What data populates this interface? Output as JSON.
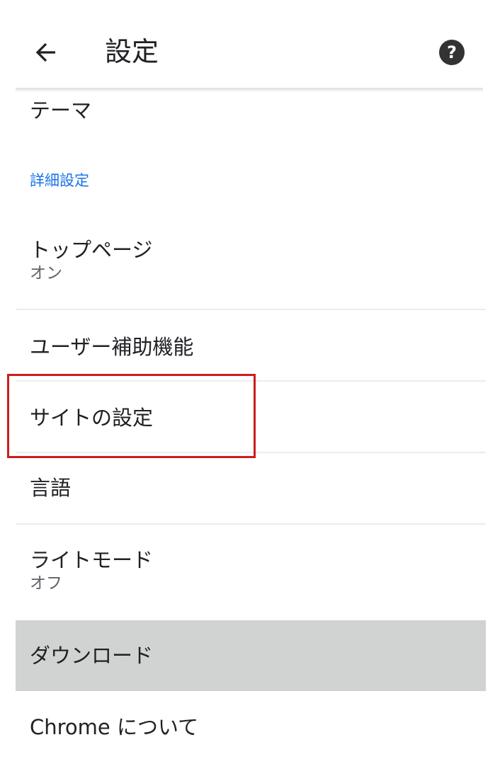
{
  "appbar": {
    "title": "設定",
    "back_icon": "arrow-left-icon",
    "help_icon": "help-circle-icon",
    "help_glyph": "?"
  },
  "settings": {
    "theme": {
      "label": "テーマ"
    },
    "advanced_header": "詳細設定",
    "homepage": {
      "label": "トップページ",
      "summary": "オン"
    },
    "accessibility": {
      "label": "ユーザー補助機能"
    },
    "site_settings": {
      "label": "サイトの設定"
    },
    "languages": {
      "label": "言語"
    },
    "lite_mode": {
      "label": "ライトモード",
      "summary": "オフ"
    },
    "downloads": {
      "label": "ダウンロード"
    },
    "about": {
      "label": "Chrome について"
    }
  },
  "colors": {
    "accent": "#1a73e8",
    "highlight_border": "#cc1d1d",
    "pressed_row": "#d1d3d2"
  }
}
